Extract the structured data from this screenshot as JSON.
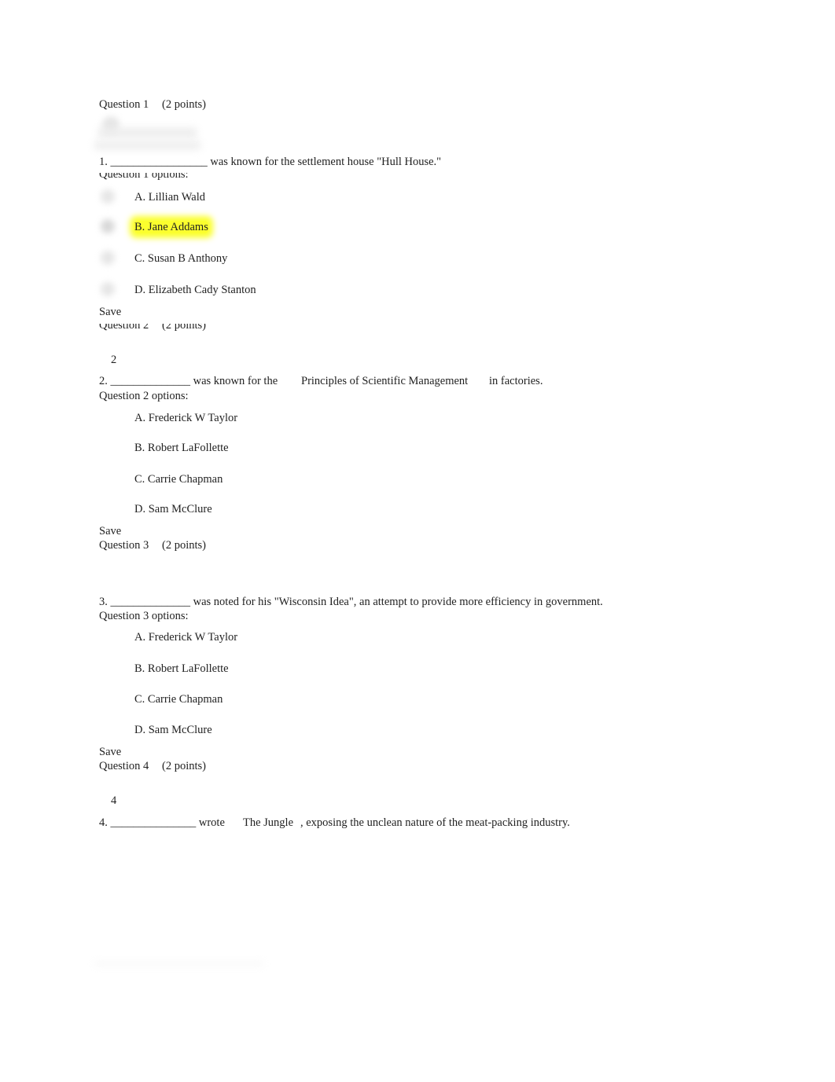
{
  "questions": [
    {
      "header": "Question 1",
      "points": "(2 points)",
      "number_marker": "",
      "prompt": "1. _________________ was known for the settlement house \"Hull House.\"",
      "options_label": "Question 1 options:",
      "options": [
        "A. Lillian Wald",
        "B. Jane Addams",
        "C. Susan B Anthony",
        "D. Elizabeth Cady Stanton"
      ],
      "highlighted_option": "B. Jane Addams",
      "save_label": "Save"
    },
    {
      "header": "Question 2",
      "points": "(2 points)",
      "number_marker": "2",
      "prompt_parts": [
        "2. ______________ was known for the",
        "Principles of Scientific Management",
        "in factories."
      ],
      "options_label": "Question 2 options:",
      "options": [
        "A. Frederick W Taylor",
        "B. Robert LaFollette",
        "C. Carrie Chapman",
        "D. Sam McClure"
      ],
      "save_label": "Save"
    },
    {
      "header": "Question 3",
      "points": "(2 points)",
      "prompt": "3. ______________ was noted for his \"Wisconsin Idea\", an attempt to provide more efficiency in government.",
      "options_label": "Question 3 options:",
      "options": [
        "A. Frederick W Taylor",
        "B. Robert LaFollette",
        "C. Carrie Chapman",
        "D. Sam McClure"
      ],
      "save_label": "Save"
    },
    {
      "header": "Question 4",
      "points": "(2 points)",
      "number_marker": "4",
      "prompt_parts": [
        "4. _______________ wrote",
        "The Jungle",
        ", exposing the unclean nature of the meat-packing industry."
      ]
    }
  ],
  "colors": {
    "highlight": "#fbff2e",
    "text": "#222222"
  }
}
